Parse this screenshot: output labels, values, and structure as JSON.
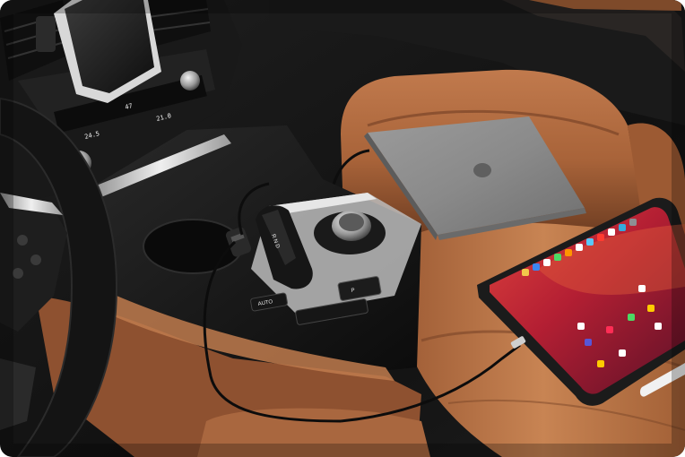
{
  "scene": {
    "dash_display": {
      "left_temp": "24.5",
      "right_temp": "21.0",
      "left_digits": "47",
      "right_digits": "47"
    },
    "console": {
      "gear_letters": "R N D",
      "knob_label": "",
      "button_labels": [
        "AUTO",
        "P"
      ]
    }
  },
  "palette": {
    "leather": "#b46f45",
    "leather_dark": "#7a4528",
    "dash": "#151515",
    "chrome": "#c9c9c9",
    "laptop": "#8a8a8a",
    "tablet_screen": "#c62a34"
  }
}
